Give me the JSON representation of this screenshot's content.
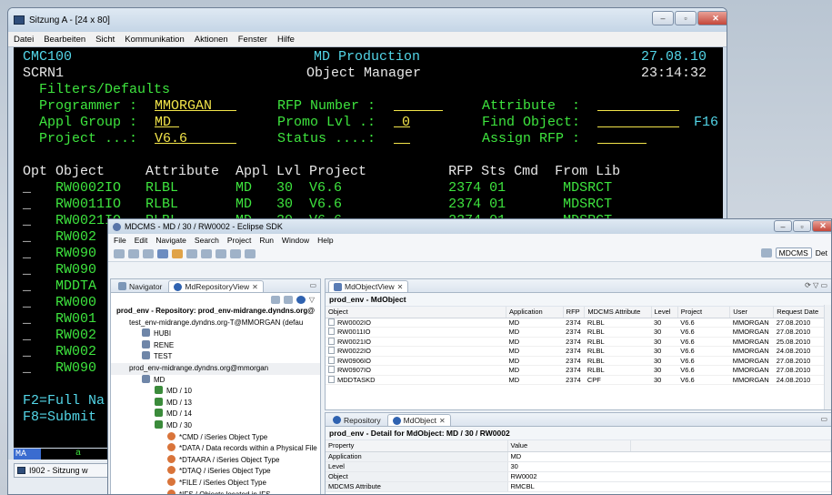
{
  "terminal": {
    "title": "Sitzung A - [24 x 80]",
    "menu": [
      "Datei",
      "Bearbeiten",
      "Sicht",
      "Kommunikation",
      "Aktionen",
      "Fenster",
      "Hilfe"
    ],
    "screen": {
      "line1": {
        "left": "CMC100",
        "center": "MD Production",
        "right": "27.08.10"
      },
      "line2": {
        "left": "SCRN1",
        "center": "Object Manager",
        "right": "23:14:32"
      },
      "filters_label": "Filters/Defaults",
      "programmer_label": "Programmer :",
      "programmer_value": "MMORGAN   ",
      "rfp_label": "RFP Number :",
      "rfp_value": "      ",
      "attribute_label": "Attribute  :",
      "attribute_value": "          ",
      "applgroup_label": "Appl Group :",
      "applgroup_value": "MD ",
      "promo_label": "Promo Lvl .:",
      "promo_value": " 0",
      "findobj_label": "Find Object:",
      "findobj_value": "          ",
      "findobj_suffix": "F16",
      "project_label": "Project ...:",
      "project_value": "V6.6      ",
      "status_label": "Status ....:",
      "status_value": "  ",
      "assign_label": "Assign RFP :",
      "assign_value": "      ",
      "header": "Opt Object     Attribute  Appl Lvl Project          RFP Sts Cmd  From Lib",
      "rows": [
        {
          "opt": "_",
          "text": "RW0002IO   RLBL       MD   30  V6.6             2374 01       MDSRCT"
        },
        {
          "opt": "_",
          "text": "RW0011IO   RLBL       MD   30  V6.6             2374 01       MDSRCT"
        },
        {
          "opt": "_",
          "text": "RW0021IO   RLBL       MD   30  V6.6             2374 01       MDSRCT"
        },
        {
          "opt": "_",
          "text": "RW002"
        },
        {
          "opt": "_",
          "text": "RW090"
        },
        {
          "opt": "_",
          "text": "RW090"
        },
        {
          "opt": "_",
          "text": "MDDTA"
        },
        {
          "opt": "_",
          "text": "RW000"
        },
        {
          "opt": "_",
          "text": "RW001"
        },
        {
          "opt": "_",
          "text": "RW002"
        },
        {
          "opt": "_",
          "text": "RW002"
        },
        {
          "opt": "_",
          "text": "RW090"
        }
      ],
      "f2": "F2=Full Na",
      "f8": "F8=Submit"
    },
    "status_mode": "MA",
    "status_char": "a",
    "taskbar_item": "I902 - Sitzung w"
  },
  "eclipse": {
    "title": "MDCMS - MD / 30 / RW0002 - Eclipse SDK",
    "menu": [
      "File",
      "Edit",
      "Navigate",
      "Search",
      "Project",
      "Run",
      "Window",
      "Help"
    ],
    "perspectives": [
      "MDCMS",
      "Det"
    ],
    "navigator_tab": "Navigator",
    "repo_tab": "MdRepositoryView",
    "tree": [
      {
        "indent": 0,
        "text": "prod_env - Repository: prod_env-midrange.dyndns.org@",
        "bold": true
      },
      {
        "indent": 1,
        "text": "test_env-midrange.dyndns.org-T@MMORGAN (defau"
      },
      {
        "indent": 2,
        "icon": "folder",
        "text": "HUBI"
      },
      {
        "indent": 2,
        "icon": "folder",
        "text": "RENE"
      },
      {
        "indent": 2,
        "icon": "folder",
        "text": "TEST"
      },
      {
        "indent": 1,
        "text": "prod_env-midrange.dyndns.org@mmorgan",
        "sel": true
      },
      {
        "indent": 2,
        "icon": "folder",
        "text": "MD"
      },
      {
        "indent": 3,
        "icon": "level",
        "text": "MD / 10"
      },
      {
        "indent": 3,
        "icon": "level",
        "text": "MD / 13"
      },
      {
        "indent": 3,
        "icon": "level",
        "text": "MD / 14"
      },
      {
        "indent": 3,
        "icon": "level",
        "text": "MD / 30"
      },
      {
        "indent": 4,
        "icon": "type",
        "text": "*CMD / iSeries Object Type"
      },
      {
        "indent": 4,
        "icon": "type",
        "text": "*DATA / Data records within a Physical File"
      },
      {
        "indent": 4,
        "icon": "type",
        "text": "*DTAARA / iSeries Object Type"
      },
      {
        "indent": 4,
        "icon": "type",
        "text": "*DTAQ / iSeries Object Type"
      },
      {
        "indent": 4,
        "icon": "type",
        "text": "*FILE / iSeries Object Type"
      },
      {
        "indent": 4,
        "icon": "type",
        "text": "*IFS / Objects located in IFS"
      }
    ],
    "objectview_tab": "MdObjectView",
    "objectview_title": "prod_env - MdObject",
    "columns": [
      "Object",
      "Application",
      "RFP",
      "MDCMS Attribute",
      "Level",
      "Project",
      "User",
      "Request Date"
    ],
    "objects": [
      [
        "RW0002IO",
        "MD",
        "2374",
        "RLBL",
        "30",
        "V6.6",
        "MMORGAN",
        "27.08.2010"
      ],
      [
        "RW0011IO",
        "MD",
        "2374",
        "RLBL",
        "30",
        "V6.6",
        "MMORGAN",
        "27.08.2010"
      ],
      [
        "RW0021IO",
        "MD",
        "2374",
        "RLBL",
        "30",
        "V6.6",
        "MMORGAN",
        "25.08.2010"
      ],
      [
        "RW0022IO",
        "MD",
        "2374",
        "RLBL",
        "30",
        "V6.6",
        "MMORGAN",
        "24.08.2010"
      ],
      [
        "RW0906IO",
        "MD",
        "2374",
        "RLBL",
        "30",
        "V6.6",
        "MMORGAN",
        "27.08.2010"
      ],
      [
        "RW0907IO",
        "MD",
        "2374",
        "RLBL",
        "30",
        "V6.6",
        "MMORGAN",
        "27.08.2010"
      ],
      [
        "MDDTASKD",
        "MD",
        "2374",
        "CPF",
        "30",
        "V6.6",
        "MMORGAN",
        "24.08.2010"
      ]
    ],
    "bottom_tabs": [
      "Repository",
      "MdObject"
    ],
    "detail_title": "prod_env - Detail for MdObject: MD / 30 / RW0002",
    "prop_columns": [
      "Property",
      "Value"
    ],
    "props": [
      [
        "Application",
        "MD"
      ],
      [
        "Level",
        "30"
      ],
      [
        "Object",
        "RW0002"
      ],
      [
        "MDCMS Attribute",
        "RMCBL"
      ]
    ]
  }
}
